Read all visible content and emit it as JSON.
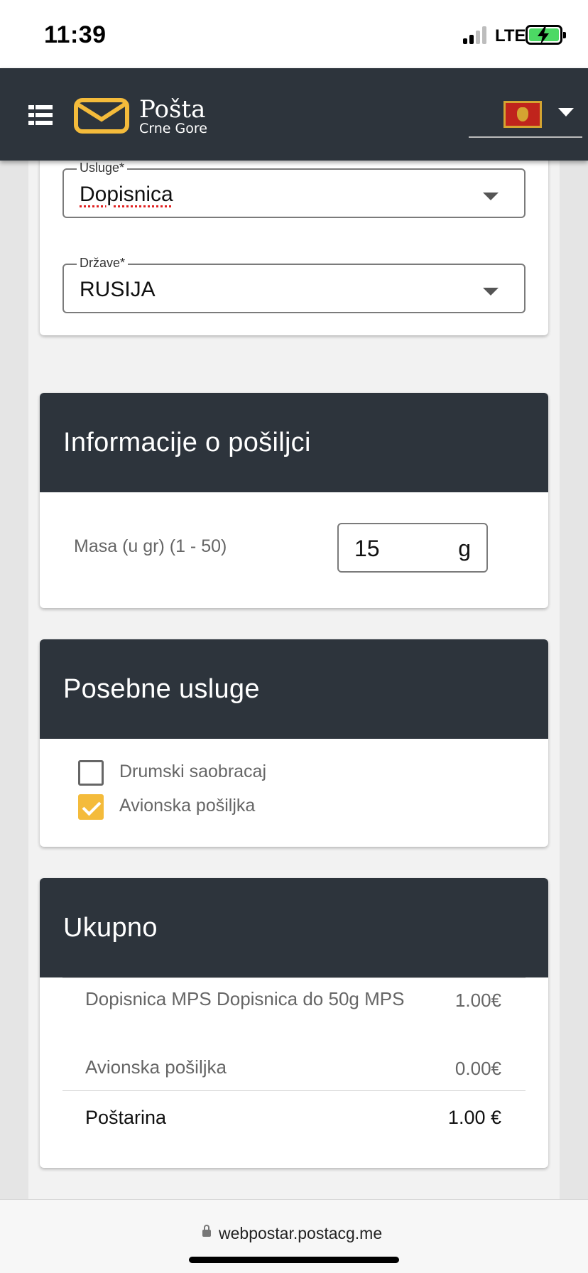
{
  "status_bar": {
    "time": "11:39",
    "network": "LTE"
  },
  "header": {
    "logo_name": "Pošta",
    "logo_sub": "Crne Gore",
    "language_flag": "montenegro-flag-icon"
  },
  "selection": {
    "service_label": "Usluge*",
    "service_value": "Dopisnica",
    "country_label": "Države*",
    "country_value": "RUSIJA"
  },
  "shipment": {
    "title": "Informacije o pošiljci",
    "mass_label": "Masa (u gr) (1 - 50)",
    "mass_value": "15",
    "mass_unit": "g"
  },
  "special_services": {
    "title": "Posebne usluge",
    "options": [
      {
        "label": "Drumski saobracaj",
        "checked": false
      },
      {
        "label": "Avionska pošiljka",
        "checked": true
      }
    ]
  },
  "total": {
    "title": "Ukupno",
    "items": [
      {
        "desc": "Dopisnica MPS Dopisnica do 50g MPS",
        "price": "1.00€"
      },
      {
        "desc": "Avionska pošiljka",
        "price": "0.00€"
      }
    ],
    "postage_label": "Poštarina",
    "postage_value": "1.00 €"
  },
  "browser": {
    "url": "webpostar.postacg.me"
  },
  "colors": {
    "header_bg": "#2d343c",
    "accent": "#f4bb3b",
    "flag_red": "#c0241c"
  }
}
